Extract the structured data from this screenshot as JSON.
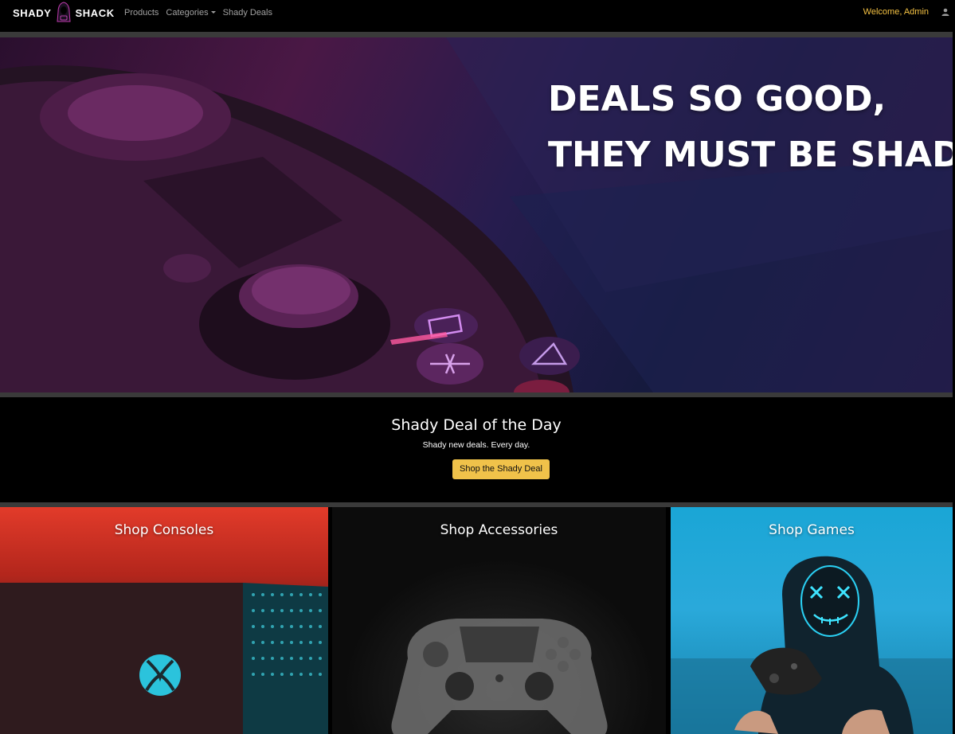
{
  "brand": {
    "word_left": "SHADY",
    "word_right": "SHACK",
    "logo_icon": "hooded-figure-icon"
  },
  "nav": {
    "items": [
      {
        "label": "Products"
      },
      {
        "label": "Categories",
        "has_dropdown": true
      },
      {
        "label": "Shady Deals"
      }
    ],
    "welcome": "Welcome, Admin",
    "user_icon": "user-icon"
  },
  "hero": {
    "line1": "DEALS SO GOOD,",
    "line2": "THEY MUST BE SHADY"
  },
  "deal": {
    "title": "Shady Deal of the Day",
    "subtitle": "Shady new deals. Every day.",
    "button_label": "Shop the Shady Deal"
  },
  "cards": [
    {
      "title": "Shop Consoles"
    },
    {
      "title": "Shop Accessories"
    },
    {
      "title": "Shop Games"
    }
  ],
  "colors": {
    "accent": "#f0c24a",
    "welcome_text": "#f6c343",
    "background": "#000000"
  }
}
